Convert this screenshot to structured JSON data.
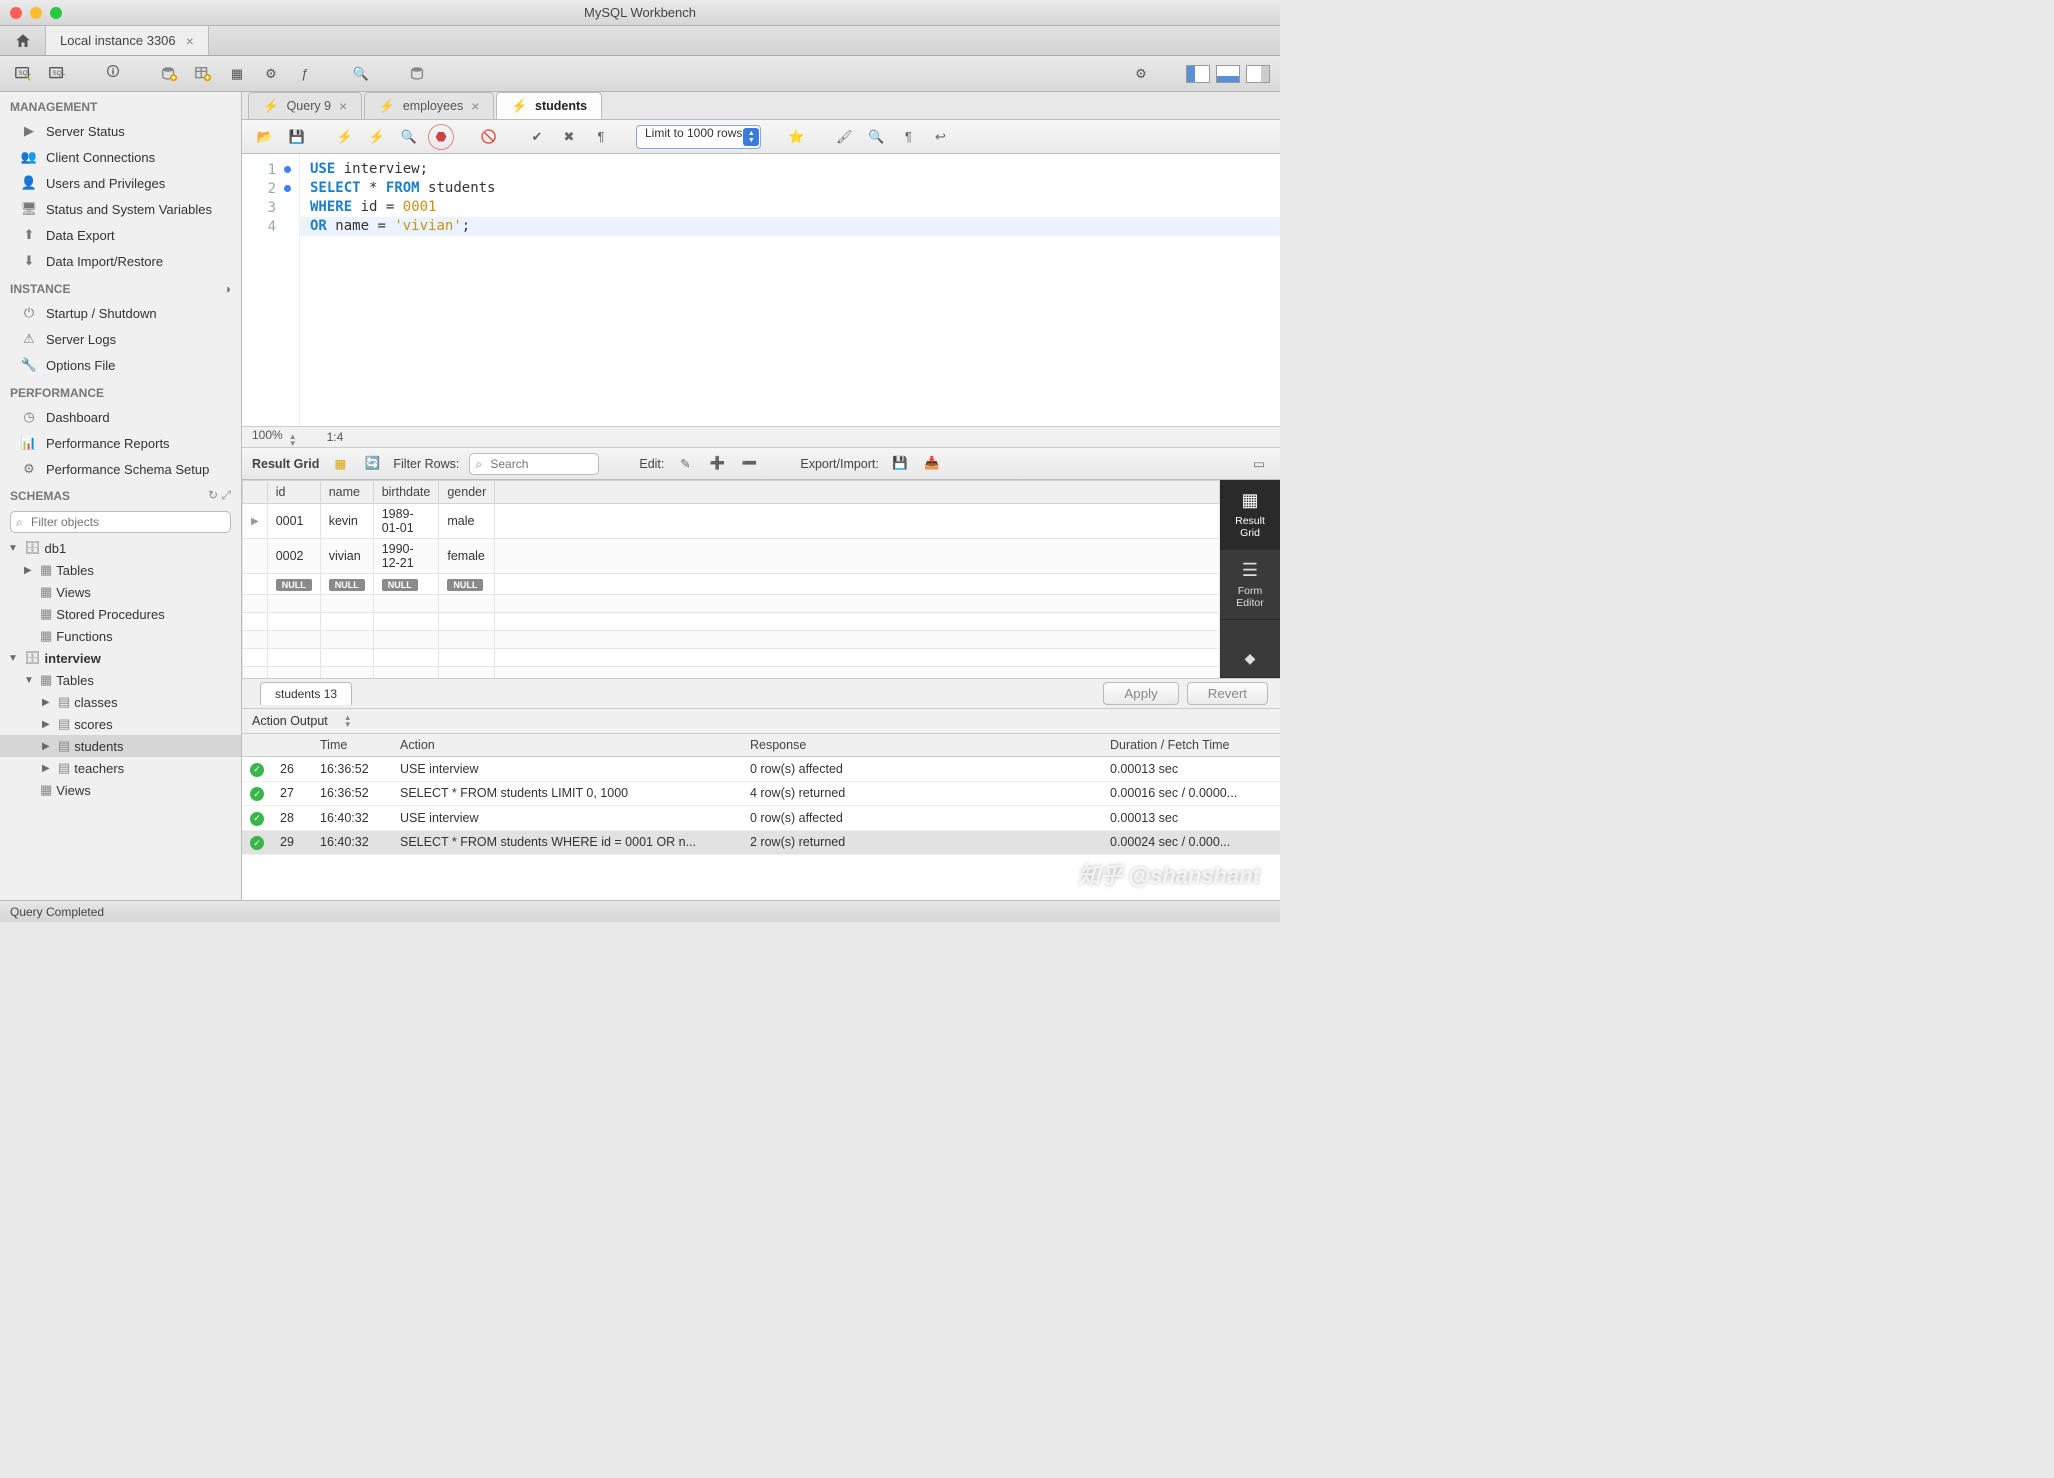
{
  "window": {
    "title": "MySQL Workbench"
  },
  "connection_tab": {
    "label": "Local instance 3306"
  },
  "sidebar": {
    "management": {
      "title": "MANAGEMENT",
      "items": [
        "Server Status",
        "Client Connections",
        "Users and Privileges",
        "Status and System Variables",
        "Data Export",
        "Data Import/Restore"
      ]
    },
    "instance": {
      "title": "INSTANCE",
      "items": [
        "Startup / Shutdown",
        "Server Logs",
        "Options File"
      ]
    },
    "performance": {
      "title": "PERFORMANCE",
      "items": [
        "Dashboard",
        "Performance Reports",
        "Performance Schema Setup"
      ]
    },
    "schemas": {
      "title": "SCHEMAS",
      "filter_placeholder": "Filter objects",
      "tree": {
        "db1": {
          "children": [
            "Tables",
            "Views",
            "Stored Procedures",
            "Functions"
          ]
        },
        "interview": {
          "bold": true,
          "tables": [
            "classes",
            "scores",
            "students",
            "teachers"
          ],
          "children_after": [
            "Views"
          ]
        }
      }
    }
  },
  "query_tabs": [
    {
      "label": "Query 9",
      "active": false,
      "closable": true
    },
    {
      "label": "employees",
      "active": false,
      "closable": true
    },
    {
      "label": "students",
      "active": true,
      "closable": false
    }
  ],
  "editor": {
    "limit_label": "Limit to 1000 rows",
    "zoom": "100%",
    "cursor": "1:4",
    "lines": [
      {
        "n": 1,
        "dot": true
      },
      {
        "n": 2,
        "dot": true
      },
      {
        "n": 3,
        "dot": false
      },
      {
        "n": 4,
        "dot": false
      }
    ],
    "sql": {
      "l1": {
        "kw1": "USE",
        "ident": "interview",
        "semi": ";"
      },
      "l2": {
        "kw1": "SELECT",
        "star": "*",
        "kw2": "FROM",
        "ident": "students"
      },
      "l3": {
        "kw1": "WHERE",
        "ident": "id",
        "eq": "=",
        "num": "0001"
      },
      "l4": {
        "kw1": "OR",
        "ident": "name",
        "eq": "=",
        "str": "'vivian'",
        "semi": ";"
      }
    }
  },
  "result_grid": {
    "toolbar": {
      "label": "Result Grid",
      "filter_label": "Filter Rows:",
      "search_placeholder": "Search",
      "edit_label": "Edit:",
      "export_label": "Export/Import:"
    },
    "columns": [
      "id",
      "name",
      "birthdate",
      "gender"
    ],
    "rows": [
      {
        "id": "0001",
        "name": "kevin",
        "birthdate": "1989-01-01",
        "gender": "male"
      },
      {
        "id": "0002",
        "name": "vivian",
        "birthdate": "1990-12-21",
        "gender": "female"
      }
    ],
    "null_row": true,
    "side_tabs": [
      {
        "label": "Result Grid",
        "active": true
      },
      {
        "label": "Form Editor",
        "active": false
      }
    ],
    "bottom_tab": "students 13",
    "apply": "Apply",
    "revert": "Revert"
  },
  "output": {
    "title": "Action Output",
    "columns": {
      "num": "",
      "time": "Time",
      "action": "Action",
      "response": "Response",
      "duration": "Duration / Fetch Time"
    },
    "rows": [
      {
        "n": "26",
        "time": "16:36:52",
        "action": "USE interview",
        "response": "0 row(s) affected",
        "duration": "0.00013 sec"
      },
      {
        "n": "27",
        "time": "16:36:52",
        "action": "SELECT * FROM students LIMIT 0, 1000",
        "response": "4 row(s) returned",
        "duration": "0.00016 sec / 0.0000..."
      },
      {
        "n": "28",
        "time": "16:40:32",
        "action": "USE interview",
        "response": "0 row(s) affected",
        "duration": "0.00013 sec"
      },
      {
        "n": "29",
        "time": "16:40:32",
        "action": "SELECT * FROM students WHERE id = 0001  OR n...",
        "response": "2 row(s) returned",
        "duration": "0.00024 sec / 0.000...",
        "selected": true
      }
    ]
  },
  "statusbar": {
    "text": "Query Completed"
  },
  "watermark": "知乎 @shanshant",
  "null_label": "NULL"
}
